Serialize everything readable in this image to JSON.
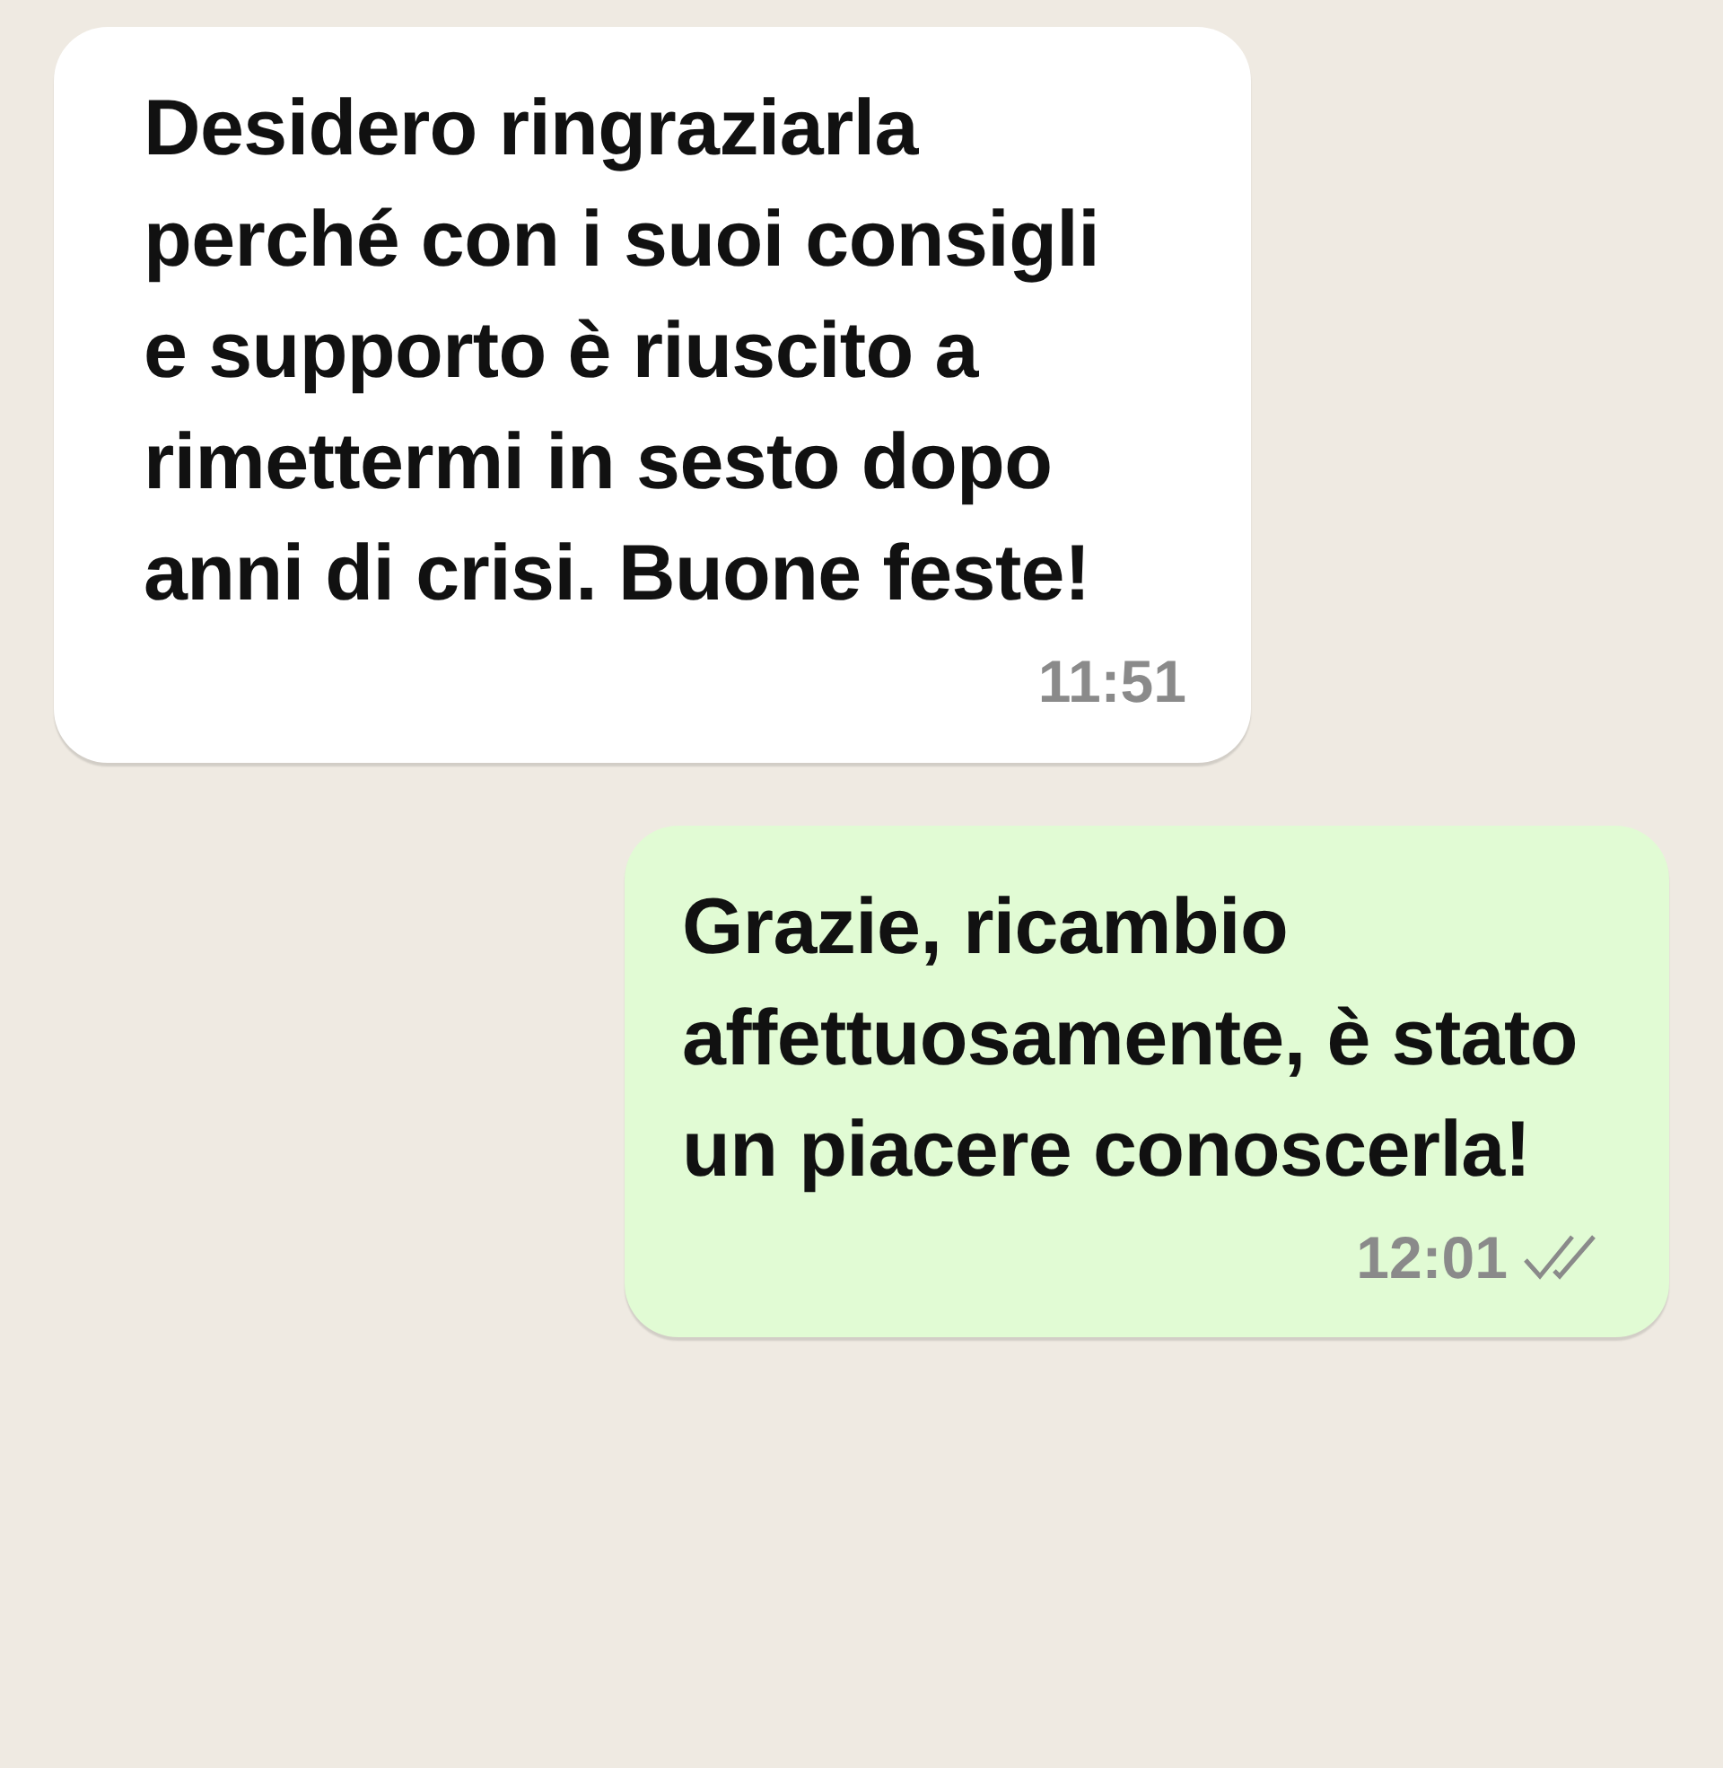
{
  "messages": [
    {
      "outgoing": false,
      "text": "Desidero ringraziarla perché con i suoi consigli e supporto è riuscito a rimettermi in sesto dopo anni di crisi. Buone feste!",
      "time": "11:51"
    },
    {
      "outgoing": true,
      "text": "Grazie, ricambio affettuosamente, è stato un piacere conoscerla!",
      "time": "12:01",
      "read": false
    }
  ]
}
